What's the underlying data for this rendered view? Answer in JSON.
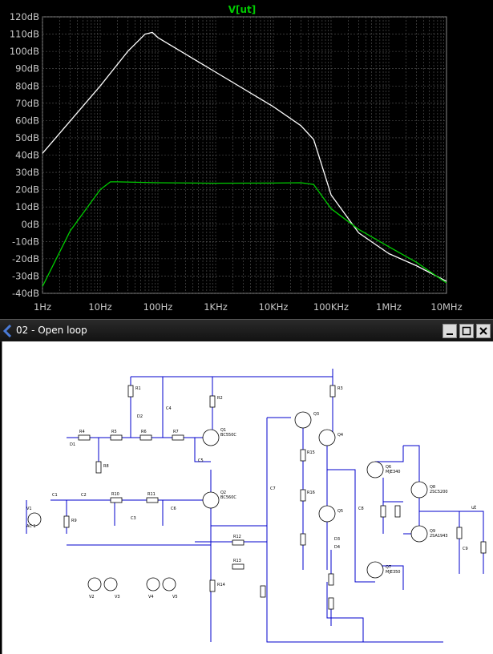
{
  "chart_data": {
    "type": "line",
    "title": "V[ut]",
    "x_scale": "log",
    "xlim": [
      1,
      10000000
    ],
    "ylim": [
      -40,
      120
    ],
    "y_ticks": [
      120,
      110,
      100,
      90,
      80,
      70,
      60,
      50,
      40,
      30,
      20,
      10,
      0,
      -10,
      -20,
      -30,
      -40
    ],
    "y_tick_labels": [
      "120dB",
      "110dB",
      "100dB",
      "90dB",
      "80dB",
      "70dB",
      "60dB",
      "50dB",
      "40dB",
      "30dB",
      "20dB",
      "10dB",
      "0dB",
      "-10dB",
      "-20dB",
      "-30dB",
      "-40dB"
    ],
    "x_ticks": [
      1,
      10,
      100,
      1000,
      10000,
      100000,
      1000000,
      10000000
    ],
    "x_tick_labels": [
      "1Hz",
      "10Hz",
      "100Hz",
      "1KHz",
      "10KHz",
      "100KHz",
      "1MHz",
      "10MHz"
    ],
    "grid": true,
    "series": [
      {
        "color": "#ffffff",
        "x": [
          1,
          10,
          30,
          60,
          80,
          100,
          1000,
          10000,
          30000,
          50000,
          100000,
          300000,
          1000000,
          3000000,
          10000000
        ],
        "y": [
          41,
          80,
          100,
          110,
          111,
          108,
          88,
          68,
          57,
          49,
          17,
          -5,
          -17,
          -24,
          -33
        ]
      },
      {
        "color": "#00cc00",
        "x": [
          1,
          3,
          10,
          15,
          20,
          100,
          1000,
          10000,
          30000,
          50000,
          100000,
          300000,
          1000000,
          3000000,
          10000000
        ],
        "y": [
          -36,
          -4,
          20,
          24.5,
          24.5,
          24,
          23.7,
          23.8,
          24,
          23,
          9,
          -3,
          -13,
          -22,
          -34
        ]
      }
    ]
  },
  "colors": {
    "trace_white": "#ffffff",
    "trace_green": "#00cc00",
    "grid": "#5a5a5a",
    "wire": "#0000cc"
  },
  "window": {
    "title": "02 - Open loop",
    "minimize_icon": "minimize-icon",
    "maximize_icon": "maximize-icon",
    "close_icon": "close-icon"
  },
  "schematic": {
    "labels": {
      "r1": "R1",
      "r2": "R2",
      "r3": "R3",
      "r4": "R4",
      "r5": "R5",
      "r6": "R6",
      "r7": "R7",
      "r8": "R8",
      "r9": "R9",
      "r10": "R10",
      "r11": "R11",
      "r12": "R12",
      "r13": "R13",
      "r14": "R14",
      "r15": "R15",
      "r16": "R16",
      "q1": "Q1",
      "q2": "Q2",
      "q3": "Q3",
      "q4": "Q4",
      "q5": "Q5",
      "q6": "Q6",
      "q7": "Q7",
      "q8": "Q8",
      "q9": "Q9",
      "c1": "C1",
      "c2": "C2",
      "c3": "C3",
      "c4": "C4",
      "c5": "C5",
      "c6": "C6",
      "c7": "C7",
      "c8": "C8",
      "c9": "C9",
      "v1": "V1",
      "v2": "V2",
      "v3": "V3",
      "v4": "V4",
      "v5": "V5",
      "d1": "D1",
      "d2": "D2",
      "d3": "D3",
      "d4": "D4",
      "bc_npn": "BC550C",
      "bc_pnp": "BC560C",
      "mjl_npn": "MJE340",
      "mjl_pnp": "MJE350",
      "out_npn": "2SC5200",
      "out_pnp": "2SA1943",
      "ut": "ut",
      "ac": "AC 1"
    }
  }
}
